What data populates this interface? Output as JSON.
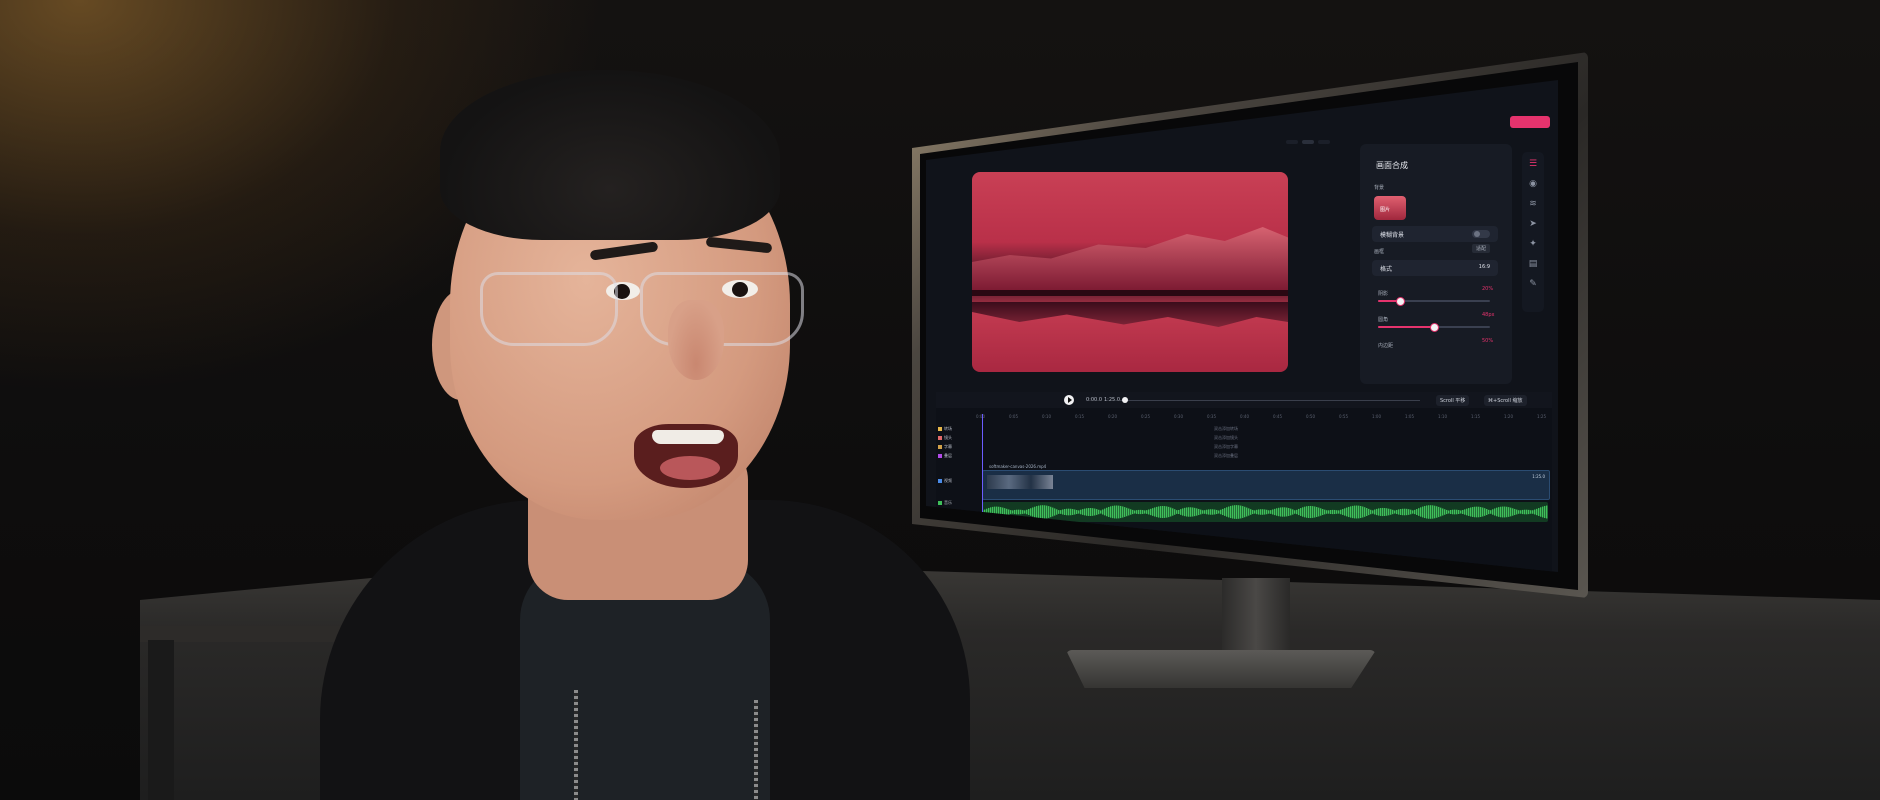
{
  "screen_ui": {
    "tabs": [
      "",
      "",
      ""
    ],
    "preview": {
      "alt": "red abstract wave preview"
    },
    "panel": {
      "title": "画面合成",
      "background_label": "背景",
      "bg_thumb_label": "图片",
      "blur_background": "模糊背景",
      "canvas_label": "画框",
      "format_label": "格式",
      "format_value": "16:9",
      "shadow_label": "阴影",
      "shadow_value": "20%",
      "shadow_pct": 0.2,
      "radius_label": "圆角",
      "radius_value": "48px",
      "radius_pct": 0.5,
      "padding_label": "内边距",
      "padding_value": "50%",
      "match_button": "适配"
    },
    "transport": {
      "timecode": "0:00.0",
      "duration": "1:25.0",
      "scroll_label": "Scroll 平移",
      "scroll_zoom_label": "⌘+Scroll 缩放"
    },
    "ruler_ticks": [
      "0:00",
      "0:05",
      "0:10",
      "0:15",
      "0:20",
      "0:25",
      "0:30",
      "0:35",
      "0:40",
      "0:45",
      "0:50",
      "0:55",
      "1:00",
      "1:05",
      "1:10",
      "1:15",
      "1:20",
      "1:25"
    ],
    "tracks": [
      {
        "name": "转场",
        "color": "#e8b84a"
      },
      {
        "name": "镜头",
        "color": "#e36a6a"
      },
      {
        "name": "字幕",
        "color": "#d2a24a"
      },
      {
        "name": "叠层",
        "color": "#b24ae8"
      },
      {
        "name": "视频",
        "color": "#4a8be8"
      },
      {
        "name": "音乐",
        "color": "#3fbf5a"
      }
    ],
    "hints": [
      "双击添加转场",
      "双击添加镜头",
      "双击添加字幕",
      "双击添加叠层"
    ],
    "video_clip": {
      "name": "softmaker-canvas-2026.mp4",
      "duration": "1:25.0"
    }
  },
  "colors": {
    "accent": "#e5336d",
    "audio": "#3fbf5a",
    "video": "#2b4c72"
  }
}
